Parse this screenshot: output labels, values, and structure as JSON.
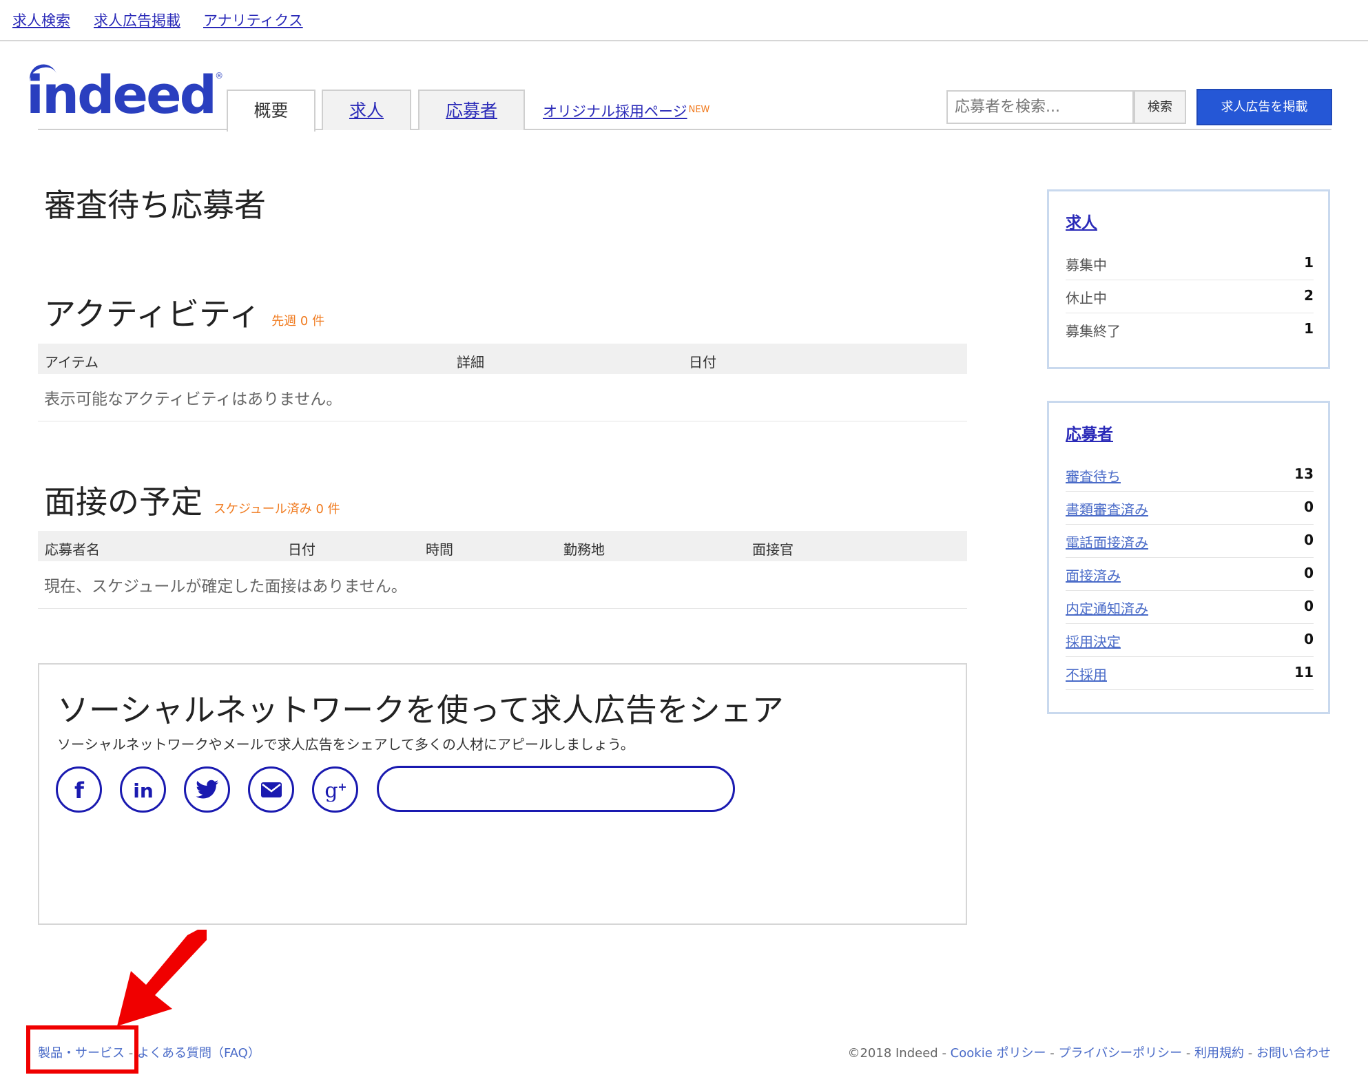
{
  "topnav": {
    "items": [
      "求人検索",
      "求人広告掲載",
      "アナリティクス"
    ]
  },
  "logo": {
    "text": "indeed",
    "reg": "®"
  },
  "tabs": [
    {
      "label": "概要"
    },
    {
      "label": "求人"
    },
    {
      "label": "応募者"
    }
  ],
  "original_page": {
    "label": "オリジナル採用ページ",
    "badge": "NEW"
  },
  "search": {
    "placeholder": "応募者を検索...",
    "button": "検索"
  },
  "post_button": "求人広告を掲載",
  "main": {
    "title": "審査待ち応募者",
    "activity": {
      "title": "アクティビティ",
      "sub": "先週 0 件",
      "columns": [
        "アイテム",
        "詳細",
        "日付"
      ],
      "empty": "表示可能なアクティビティはありません。"
    },
    "interviews": {
      "title": "面接の予定",
      "sub": "スケジュール済み 0 件",
      "columns": [
        "応募者名",
        "日付",
        "時間",
        "勤務地",
        "面接官"
      ],
      "empty": "現在、スケジュールが確定した面接はありません。"
    },
    "share": {
      "title": "ソーシャルネットワークを使って求人広告をシェア",
      "desc": "ソーシャルネットワークやメールで求人広告をシェアして多くの人材にアピールしましょう。",
      "icons": [
        "facebook-icon",
        "linkedin-icon",
        "twitter-icon",
        "email-icon",
        "google-plus-icon"
      ],
      "input_value": ""
    }
  },
  "sidebar": {
    "jobs": {
      "title": "求人",
      "rows": [
        {
          "label": "募集中",
          "value": "1"
        },
        {
          "label": "休止中",
          "value": "2"
        },
        {
          "label": "募集終了",
          "value": "1"
        }
      ]
    },
    "applicants": {
      "title": "応募者",
      "rows": [
        {
          "label": "審査待ち",
          "value": "13"
        },
        {
          "label": "書類審査済み",
          "value": "0"
        },
        {
          "label": "電話面接済み",
          "value": "0"
        },
        {
          "label": "面接済み",
          "value": "0"
        },
        {
          "label": "内定通知済み",
          "value": "0"
        },
        {
          "label": "採用決定",
          "value": "0"
        },
        {
          "label": "不採用",
          "value": "11"
        }
      ]
    }
  },
  "footer": {
    "left": [
      "製品・サービス",
      "よくある質問（FAQ）"
    ],
    "left_sep": " - ",
    "copyright": "©2018 Indeed",
    "right": [
      "Cookie ポリシー",
      "プライバシーポリシー",
      "利用規約",
      "お問い合わせ"
    ],
    "right_sep": " - "
  },
  "colors": {
    "accent": "#2557d6",
    "link": "#2a2ab8",
    "orange": "#f07a1e",
    "highlight": "#f00000"
  }
}
